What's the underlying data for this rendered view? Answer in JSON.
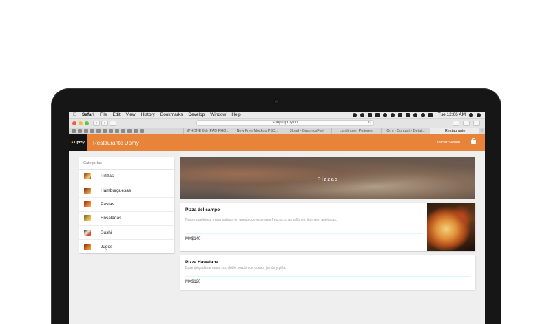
{
  "menubar": {
    "apple": "",
    "items": [
      "Safari",
      "File",
      "Edit",
      "View",
      "History",
      "Bookmarks",
      "Develop",
      "Window",
      "Help"
    ],
    "time": "Tue 12:06 AM"
  },
  "browser": {
    "url": "shop.upmy.co",
    "tabs": [
      "iPHONE 6 & iPAD PHO...",
      "New Free Mockup PSD...",
      "3load - GraphicsFuel",
      "Landing en Pinterest",
      "Crm - Contact - Detai...",
      "Restaurante"
    ]
  },
  "site": {
    "logo_text": "Upmy",
    "title": "Restaurante Upmy",
    "login": "Iniciar Sesión",
    "accent": "#e8843a"
  },
  "sidebar": {
    "title": "Categorías",
    "items": [
      {
        "label": "Pizzas"
      },
      {
        "label": "Hamburguesas"
      },
      {
        "label": "Pastas"
      },
      {
        "label": "Ensaladas"
      },
      {
        "label": "Sushi"
      },
      {
        "label": "Jugos"
      }
    ]
  },
  "hero": {
    "title": "Pizzas"
  },
  "products": [
    {
      "name": "Pizza del campo",
      "description": "Nuestra deliciosa masa bañada en queso con vegetales frescos, champiñones, jitomate, aceitunas.",
      "price": "MX$140"
    },
    {
      "name": "Pizza Hawaiana",
      "description": "Base delgada de masa con doble porción de queso, jamón y piña.",
      "price": "MX$120"
    }
  ]
}
